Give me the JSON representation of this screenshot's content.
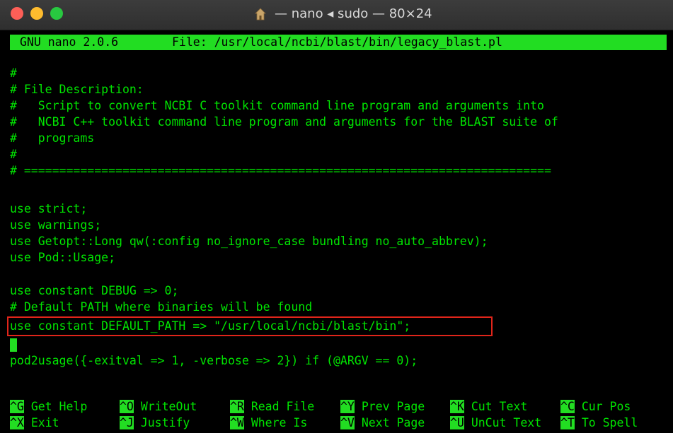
{
  "window": {
    "title": "— nano ◂ sudo — 80×24"
  },
  "nano": {
    "version_label": "GNU nano 2.0.6",
    "file_label": "File: /usr/local/ncbi/blast/bin/legacy_blast.pl"
  },
  "buffer": {
    "lines": [
      "#",
      "# File Description:",
      "#   Script to convert NCBI C toolkit command line program and arguments into",
      "#   NCBI C++ toolkit command line program and arguments for the BLAST suite of",
      "#   programs",
      "#",
      "# ===========================================================================",
      "",
      "use strict;",
      "use warnings;",
      "use Getopt::Long qw(:config no_ignore_case bundling no_auto_abbrev);",
      "use Pod::Usage;",
      "",
      "use constant DEBUG => 0;",
      "# Default PATH where binaries will be found",
      "use constant DEFAULT_PATH => \"/usr/local/ncbi/blast/bin\";",
      "",
      "pod2usage({-exitval => 1, -verbose => 2}) if (@ARGV == 0);"
    ]
  },
  "shortcuts": {
    "row1": [
      {
        "key": "^G",
        "label": "Get Help"
      },
      {
        "key": "^O",
        "label": "WriteOut"
      },
      {
        "key": "^R",
        "label": "Read File"
      },
      {
        "key": "^Y",
        "label": "Prev Page"
      },
      {
        "key": "^K",
        "label": "Cut Text"
      },
      {
        "key": "^C",
        "label": "Cur Pos"
      }
    ],
    "row2": [
      {
        "key": "^X",
        "label": "Exit"
      },
      {
        "key": "^J",
        "label": "Justify"
      },
      {
        "key": "^W",
        "label": "Where Is"
      },
      {
        "key": "^V",
        "label": "Next Page"
      },
      {
        "key": "^U",
        "label": "UnCut Text"
      },
      {
        "key": "^T",
        "label": "To Spell"
      }
    ]
  },
  "colors": {
    "text": "#00e400",
    "bar": "#22dd22",
    "highlight": "#e0251a"
  },
  "icons": {
    "title_icon": "home-icon"
  }
}
